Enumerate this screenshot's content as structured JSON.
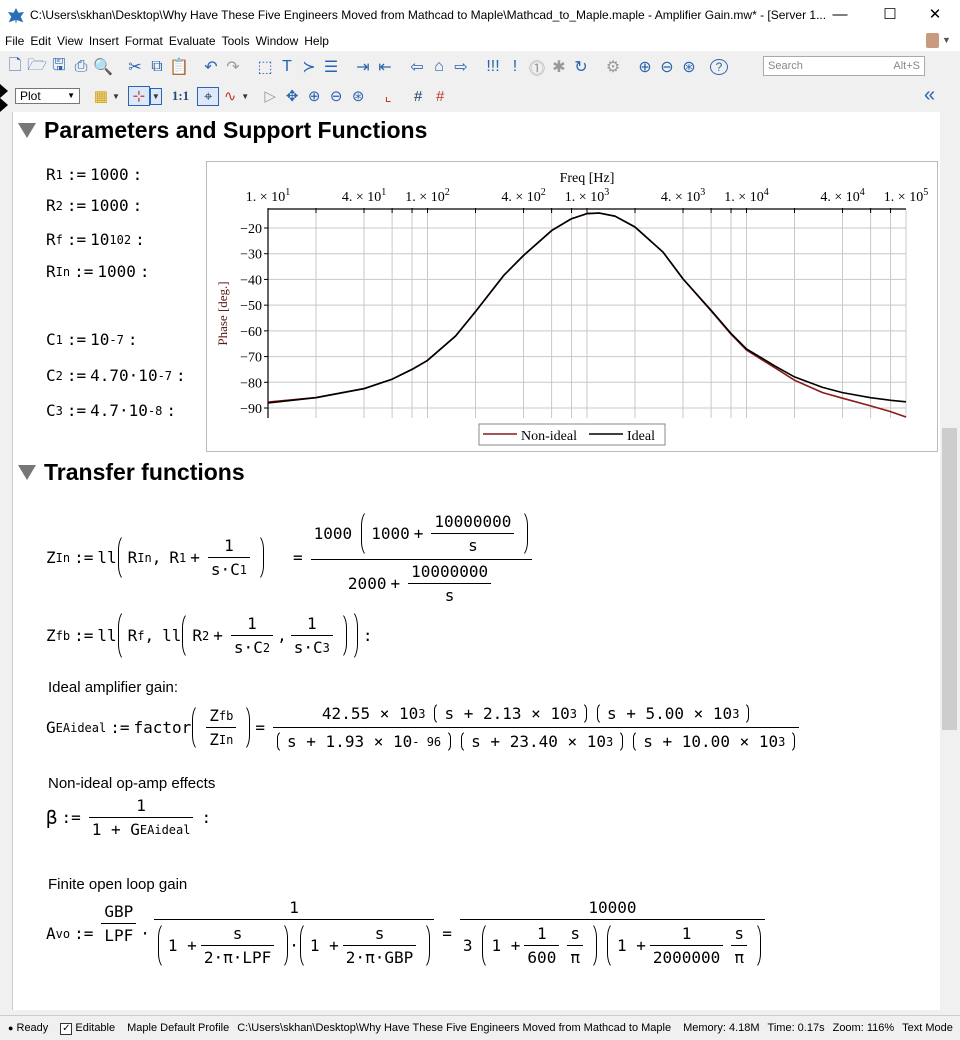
{
  "window": {
    "title": "C:\\Users\\skhan\\Desktop\\Why Have These Five Engineers Moved from Mathcad to Maple\\Mathcad_to_Maple.maple - Amplifier Gain.mw* - [Server 1...",
    "minimize": "—",
    "maximize": "☐",
    "close": "✕"
  },
  "menu": [
    "File",
    "Edit",
    "View",
    "Insert",
    "Format",
    "Evaluate",
    "Tools",
    "Window",
    "Help"
  ],
  "toolbar1": {
    "icons": [
      "new-document-icon",
      "open-icon",
      "save-icon",
      "print-icon",
      "print-preview-icon",
      "sep",
      "cut-icon",
      "copy-icon",
      "paste-icon",
      "sep",
      "undo-icon",
      "redo-icon",
      "sep",
      "text-region-icon",
      "text-mode-icon",
      "math-mode-icon",
      "execution-group-icon",
      "sep",
      "indent-icon",
      "outdent-icon",
      "sep",
      "back-icon",
      "home-icon",
      "forward-icon",
      "sep",
      "execute-all-icon",
      "execute-icon",
      "interrupt-icon",
      "debug-icon",
      "restart-icon",
      "sep",
      "connect-icon",
      "sep",
      "zoom-in-icon",
      "zoom-out-icon",
      "zoom-reset-icon",
      "sep",
      "help-icon"
    ],
    "search_placeholder": "Search",
    "search_shortcut": "Alt+S"
  },
  "toolbar2": {
    "plot_select": "Plot",
    "one_to_one": "1:1",
    "collapse": "«"
  },
  "section1": {
    "heading": "Parameters and Support Functions",
    "params": [
      {
        "name": "R",
        "sub": "1",
        "value": "1000",
        "sup": ""
      },
      {
        "name": "R",
        "sub": "2",
        "value": "1000",
        "sup": ""
      },
      {
        "name": "R",
        "sub": "f",
        "value": "10",
        "sup": "102"
      },
      {
        "name": "R",
        "sub": "In",
        "value": "1000",
        "sup": ""
      },
      {
        "name": "C",
        "sub": "1",
        "value": "10",
        "sup": "-7"
      },
      {
        "name": "C",
        "sub": "2",
        "value": "4.70·10",
        "sup": "-7"
      },
      {
        "name": "C",
        "sub": "3",
        "value": "4.7·10",
        "sup": "-8"
      }
    ]
  },
  "sym": {
    "assign": ":=",
    "end": ":",
    "plus": "+",
    "eq": "=",
    "comma": ",",
    "dot": "·"
  },
  "chart_data": {
    "type": "line",
    "xlabel": "Freq [Hz]",
    "ylabel": "Phase [deg.]",
    "xscale": "log",
    "xaxis_position": "top",
    "xlim": [
      10,
      100000
    ],
    "ylim": [
      -94,
      -12.5
    ],
    "grid": true,
    "legend": "bottom",
    "x_ticks": [
      {
        "value": 10,
        "base": "1. × 10",
        "exp": "1"
      },
      {
        "value": 40,
        "base": "4. × 10",
        "exp": "1"
      },
      {
        "value": 100,
        "base": "1. × 10",
        "exp": "2"
      },
      {
        "value": 400,
        "base": "4. × 10",
        "exp": "2"
      },
      {
        "value": 1000,
        "base": "1. × 10",
        "exp": "3"
      },
      {
        "value": 4000,
        "base": "4. × 10",
        "exp": "3"
      },
      {
        "value": 10000,
        "base": "1. × 10",
        "exp": "4"
      },
      {
        "value": 40000,
        "base": "4. × 10",
        "exp": "4"
      },
      {
        "value": 100000,
        "base": "1. × 10",
        "exp": "5"
      }
    ],
    "y_ticks": [
      -20,
      -30,
      -40,
      -50,
      -60,
      -70,
      -80,
      -90
    ],
    "x": [
      10,
      20,
      40,
      60,
      80,
      100,
      150,
      200,
      300,
      400,
      600,
      800,
      1000,
      1200,
      1500,
      2000,
      3000,
      4000,
      6000,
      8000,
      10000,
      15000,
      20000,
      30000,
      40000,
      60000,
      80000,
      100000
    ],
    "series": [
      {
        "name": "Non-ideal",
        "color": "#8b1a1a",
        "values": [
          -87.7,
          -85.9,
          -82.4,
          -78.8,
          -75,
          -71.5,
          -62,
          -52.5,
          -38.5,
          -30.7,
          -21,
          -16.4,
          -14.4,
          -14.2,
          -15.4,
          -19.6,
          -29.4,
          -39.8,
          -52.2,
          -61.3,
          -67.5,
          -74.3,
          -79.2,
          -84,
          -86.2,
          -89.2,
          -91.4,
          -93.5
        ]
      },
      {
        "name": "Ideal",
        "color": "#000000",
        "values": [
          -88,
          -86,
          -82.5,
          -78.8,
          -75,
          -71.5,
          -62,
          -52.5,
          -38.5,
          -30.7,
          -21,
          -16.4,
          -14.4,
          -14.2,
          -15.4,
          -19.6,
          -29.4,
          -39.8,
          -52,
          -61,
          -67,
          -73.6,
          -77.9,
          -82,
          -84,
          -86,
          -87,
          -87.6
        ]
      }
    ]
  },
  "section2": {
    "heading": "Transfer functions",
    "zin": {
      "lhs": "Z",
      "lhs_sub": "In",
      "fn": "ll",
      "a1": "R",
      "a1_sub": "In",
      "a2": "R",
      "a2_sub": "1",
      "num": "1",
      "den": "s·C",
      "den_sub": "1",
      "r_coef": "1000",
      "r_in": "1000",
      "r_fnum": "10000000",
      "r_fden": "s",
      "r_den": "2000",
      "r_dfnum": "10000000",
      "r_dfden": "s"
    },
    "zfb": {
      "lhs": "Z",
      "lhs_sub": "fb",
      "fn": "ll",
      "a1": "R",
      "a1_sub": "f",
      "fn2": "ll",
      "b1": "R",
      "b1_sub": "2",
      "num1": "1",
      "den1": "s·C",
      "den1_sub": "2",
      "num2": "1",
      "den2": "s·C",
      "den2_sub": "3"
    },
    "ideal_label": "Ideal amplifier gain:",
    "g": {
      "lhs": "G",
      "lhs_sub": "EAideal",
      "fn": "factor",
      "fnum": "Z",
      "fnum_sub": "fb",
      "fden": "Z",
      "fden_sub": "In",
      "n1": "42.55 × 10",
      "n1_exp": "3",
      "n2": "s + 2.13 × 10",
      "n2_exp": "3",
      "n3": "s + 5.00 × 10",
      "n3_exp": "3",
      "d1": "s + 1.93 × 10",
      "d1_exp": "- 96",
      "d2": "s + 23.40 × 10",
      "d2_exp": "3",
      "d3": "s + 10.00 × 10",
      "d3_exp": "3"
    },
    "nonideal_label": "Non-ideal op-amp effects",
    "beta": {
      "lhs": "β",
      "num": "1",
      "den": "1 + G",
      "den_sub": "EAideal"
    },
    "openloop_label": "Finite open loop gain",
    "avo": {
      "lhs": "A",
      "lhs_sub": "vo",
      "f1num": "GBP",
      "f1den": "LPF",
      "num": "1",
      "p1a": "1 +",
      "p1num": "s",
      "p1den": "2·π·LPF",
      "p2a": "1 +",
      "p2num": "s",
      "p2den": "2·π·GBP",
      "r_num": "10000",
      "r_coef": "3",
      "q1a": "1 +",
      "q1num": "1",
      "q1den": "600",
      "q1snum": "s",
      "q1sden": "π",
      "q2a": "1 +",
      "q2num": "1",
      "q2den": "2000000",
      "q2snum": "s",
      "q2sden": "π"
    }
  },
  "status": {
    "ready": "Ready",
    "editable": "Editable",
    "profile": "Maple Default Profile",
    "path": "C:\\Users\\skhan\\Desktop\\Why Have These Five Engineers Moved from Mathcad to Maple",
    "memory": "Memory: 4.18M",
    "time": "Time: 0.17s",
    "zoom": "Zoom: 116%",
    "mode": "Text Mode"
  }
}
